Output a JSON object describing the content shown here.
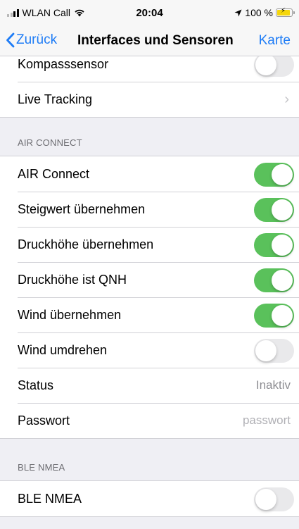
{
  "status_bar": {
    "carrier": "WLAN Call",
    "time": "20:04",
    "battery_pct": "100 %"
  },
  "nav": {
    "back_label": "Zurück",
    "title": "Interfaces und Sensoren",
    "right_label": "Karte"
  },
  "top_group": {
    "rows": [
      {
        "label": "Kompasssensor",
        "toggle": false
      },
      {
        "label": "Live Tracking"
      }
    ]
  },
  "air_connect": {
    "header": "AIR CONNECT",
    "rows": [
      {
        "label": "AIR Connect",
        "toggle": true
      },
      {
        "label": "Steigwert übernehmen",
        "toggle": true
      },
      {
        "label": "Druckhöhe übernehmen",
        "toggle": true
      },
      {
        "label": "Druckhöhe ist QNH",
        "toggle": true
      },
      {
        "label": "Wind übernehmen",
        "toggle": true
      },
      {
        "label": "Wind umdrehen",
        "toggle": false
      },
      {
        "label": "Status",
        "value": "Inaktiv"
      },
      {
        "label": "Passwort",
        "placeholder": "passwort"
      }
    ]
  },
  "ble_nmea": {
    "header": "BLE NMEA",
    "rows": [
      {
        "label": "BLE NMEA",
        "toggle": false
      }
    ]
  },
  "colors": {
    "accent": "#1e7cf6",
    "toggle_on": "#5ac15b",
    "toggle_off": "#e9e9eb",
    "background": "#efeff4"
  }
}
